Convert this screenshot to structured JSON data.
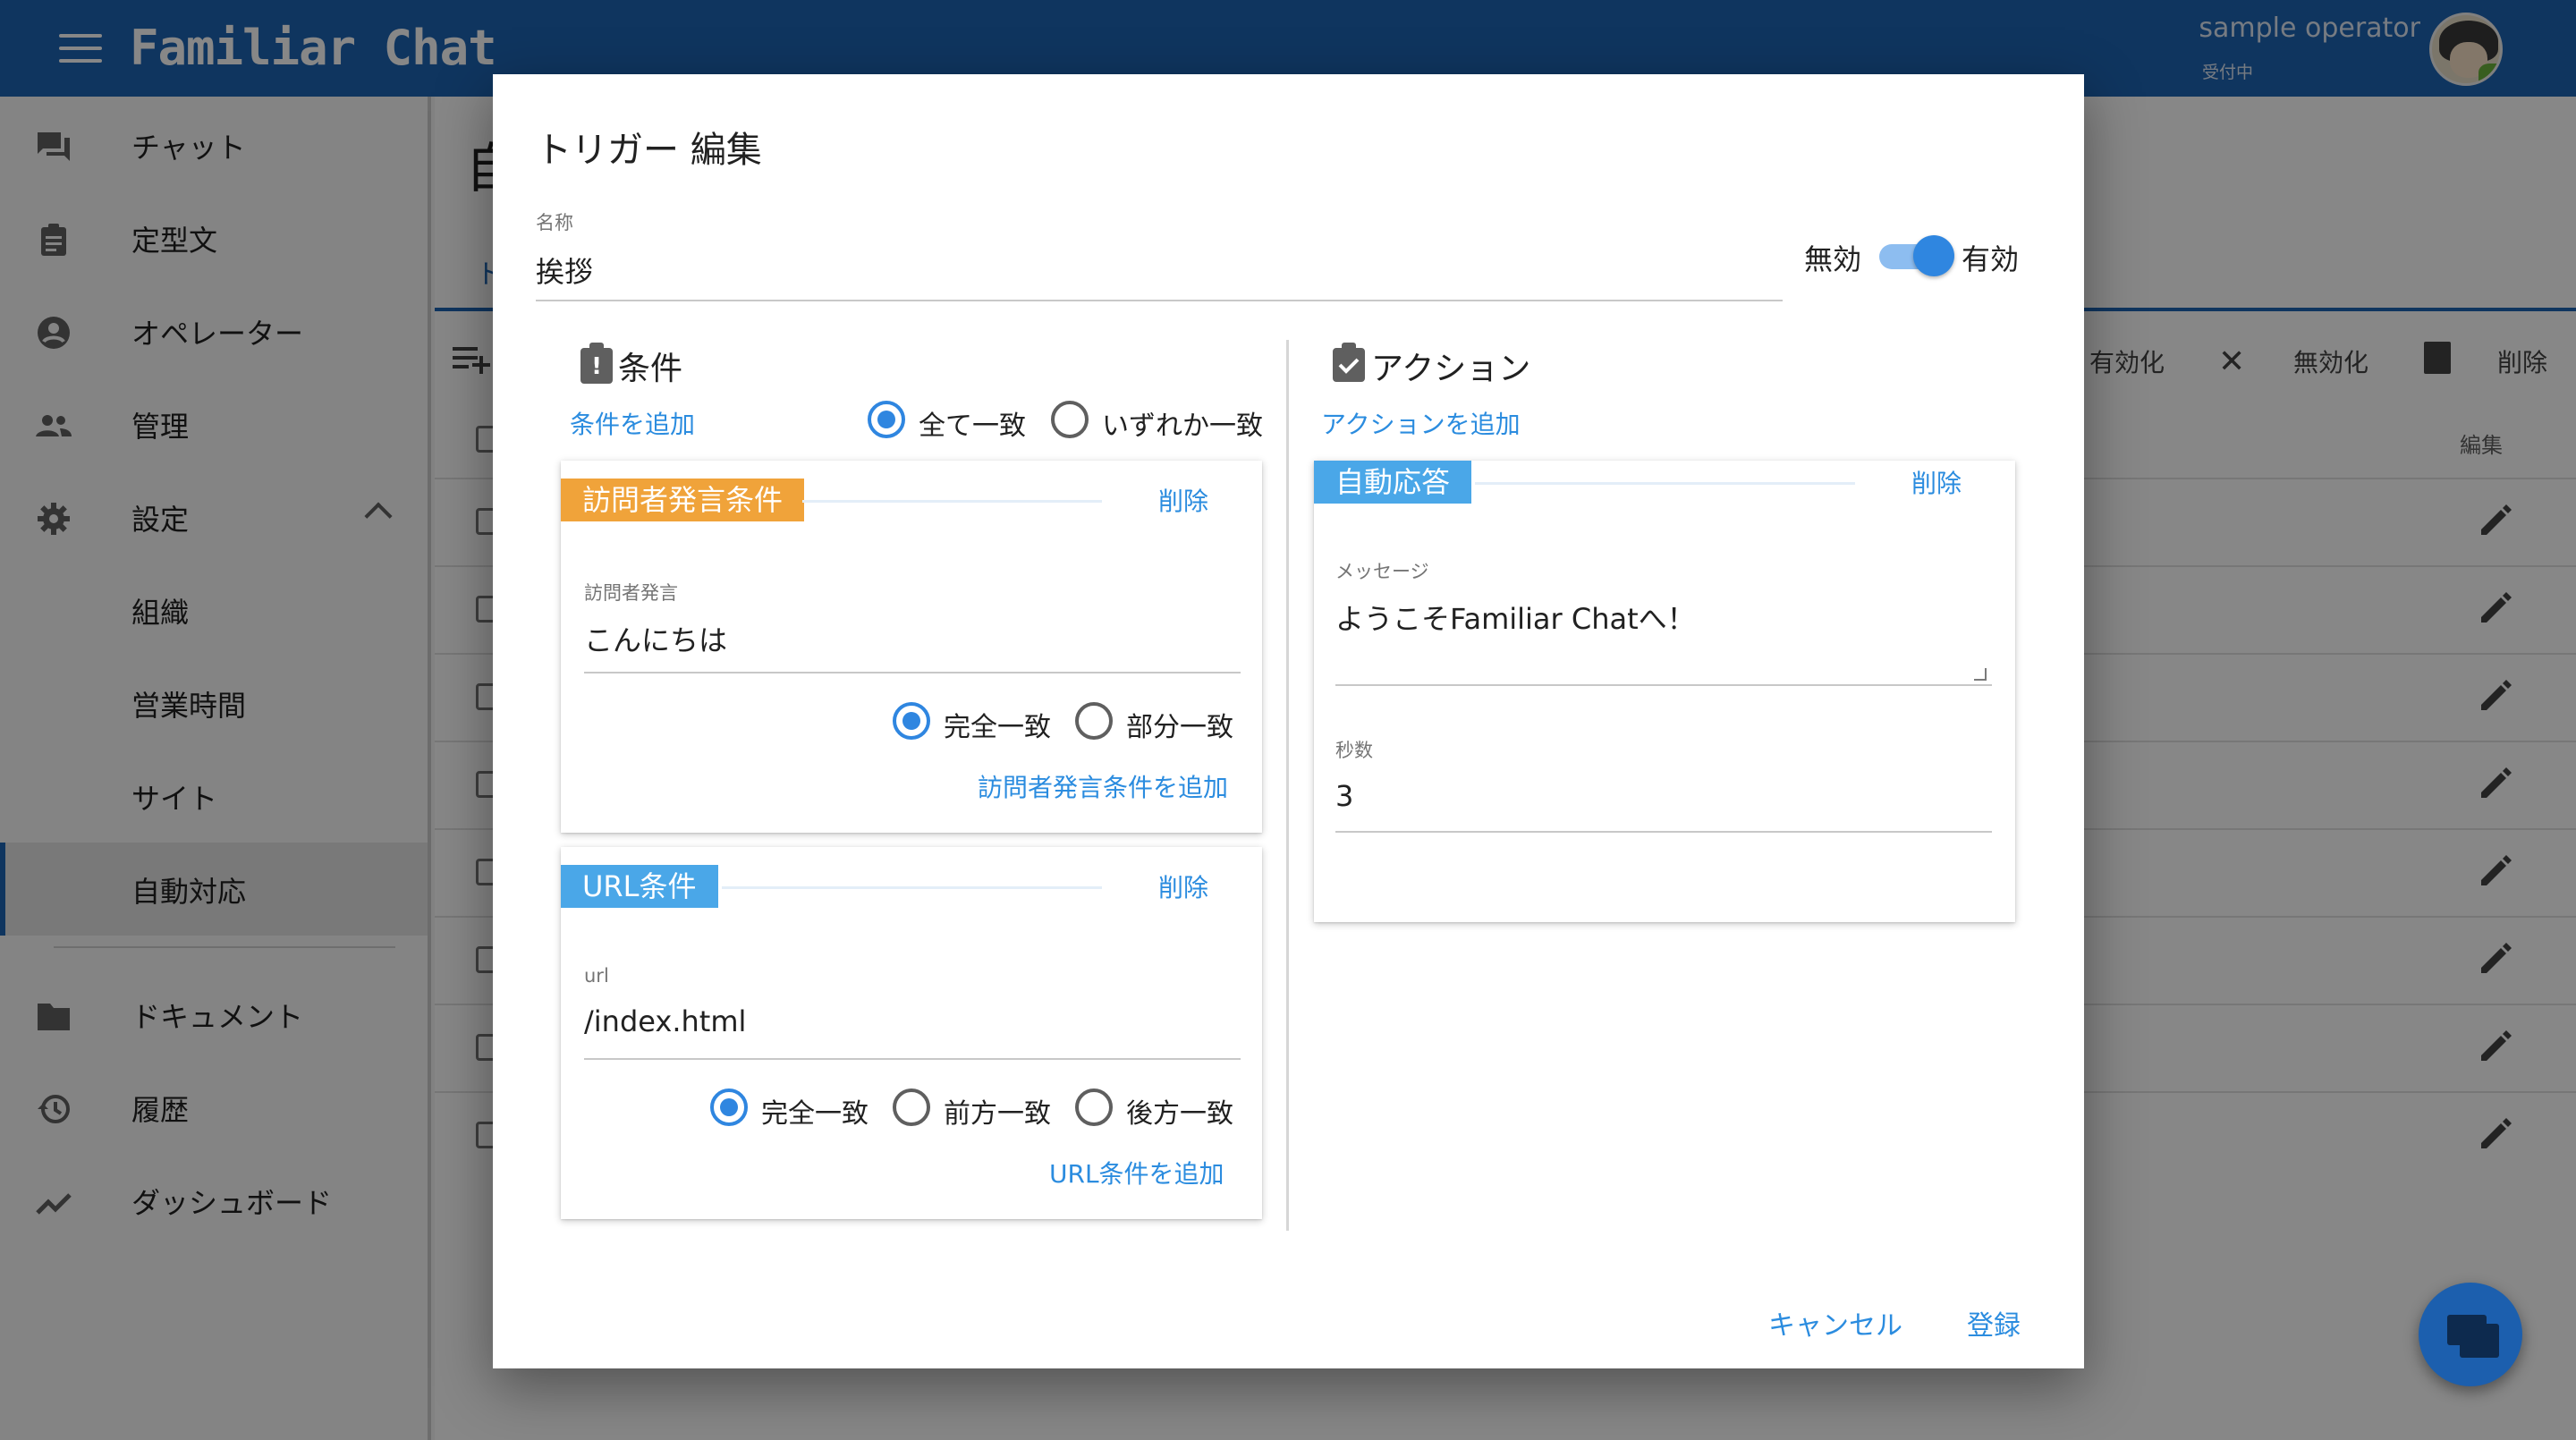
{
  "appbar": {
    "brand": "Familiar Chat",
    "operator_name": "sample operator",
    "operator_status": "受付中"
  },
  "sidebar": {
    "items": [
      {
        "label": "チャット",
        "icon": "chat-icon"
      },
      {
        "label": "定型文",
        "icon": "clipboard-icon"
      },
      {
        "label": "オペレーター",
        "icon": "account-circle-icon"
      },
      {
        "label": "管理",
        "icon": "people-icon"
      },
      {
        "label": "設定",
        "icon": "gear-icon"
      },
      {
        "label": "組織",
        "icon": ""
      },
      {
        "label": "営業時間",
        "icon": ""
      },
      {
        "label": "サイト",
        "icon": ""
      },
      {
        "label": "自動対応",
        "icon": "",
        "active": true
      },
      {
        "label": "ドキュメント",
        "icon": "folder-icon"
      },
      {
        "label": "履歴",
        "icon": "history-icon"
      },
      {
        "label": "ダッシュボード",
        "icon": "trending-icon"
      }
    ]
  },
  "background": {
    "title_fragment": "自",
    "tab_fragment": "ト",
    "toolbar": {
      "enable_label": "有効化",
      "disable_label": "無効化",
      "delete_label": "削除"
    },
    "edit_header": "編集"
  },
  "dialog": {
    "title": "トリガー 編集",
    "name_label": "名称",
    "name_value": "挨拶",
    "toggle_off_label": "無効",
    "toggle_on_label": "有効",
    "toggle_enabled": true,
    "conditions": {
      "heading": "条件",
      "add_link": "条件を追加",
      "match_all": "全て一致",
      "match_any": "いずれか一致",
      "selected": "全て一致",
      "visitor_card": {
        "chip": "訪問者発言条件",
        "delete": "削除",
        "field_label": "訪問者発言",
        "field_value": "こんにちは",
        "exact": "完全一致",
        "partial": "部分一致",
        "selected": "完全一致",
        "add_link": "訪問者発言条件を追加"
      },
      "url_card": {
        "chip": "URL条件",
        "delete": "削除",
        "field_label": "url",
        "field_value": "/index.html",
        "exact": "完全一致",
        "prefix": "前方一致",
        "suffix": "後方一致",
        "selected": "完全一致",
        "add_link": "URL条件を追加"
      }
    },
    "actions": {
      "heading": "アクション",
      "add_link": "アクションを追加",
      "auto_reply_card": {
        "chip": "自動応答",
        "delete": "削除",
        "message_label": "メッセージ",
        "message_value": "ようこそFamiliar Chatへ！",
        "seconds_label": "秒数",
        "seconds_value": "3"
      }
    },
    "cancel": "キャンセル",
    "submit": "登録"
  },
  "colors": {
    "primary": "#1e64b4",
    "accent": "#2f86e0",
    "chip_orange": "#f0a33a",
    "chip_blue": "#4aa7e8"
  }
}
